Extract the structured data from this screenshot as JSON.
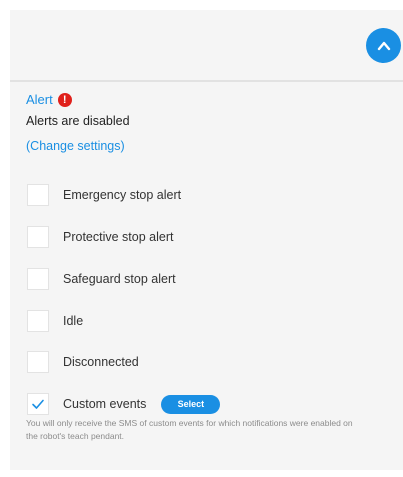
{
  "panel": {
    "collapse_icon": "chevron-up-icon",
    "accent_color": "#1a8fe3",
    "alert_color": "#e0201b"
  },
  "alert": {
    "title": "Alert",
    "warning_icon_glyph": "!",
    "status": "Alerts are disabled",
    "change_settings": "(Change settings)"
  },
  "options": [
    {
      "label": "Emergency stop alert",
      "checked": false
    },
    {
      "label": "Protective stop alert",
      "checked": false
    },
    {
      "label": "Safeguard stop alert",
      "checked": false
    },
    {
      "label": "Idle",
      "checked": false
    },
    {
      "label": "Disconnected",
      "checked": false
    },
    {
      "label": "Custom events",
      "checked": true
    }
  ],
  "custom_events": {
    "select_label": "Select",
    "note": "You will only receive the SMS of custom events for which notifications were enabled on the robot's teach pendant."
  }
}
